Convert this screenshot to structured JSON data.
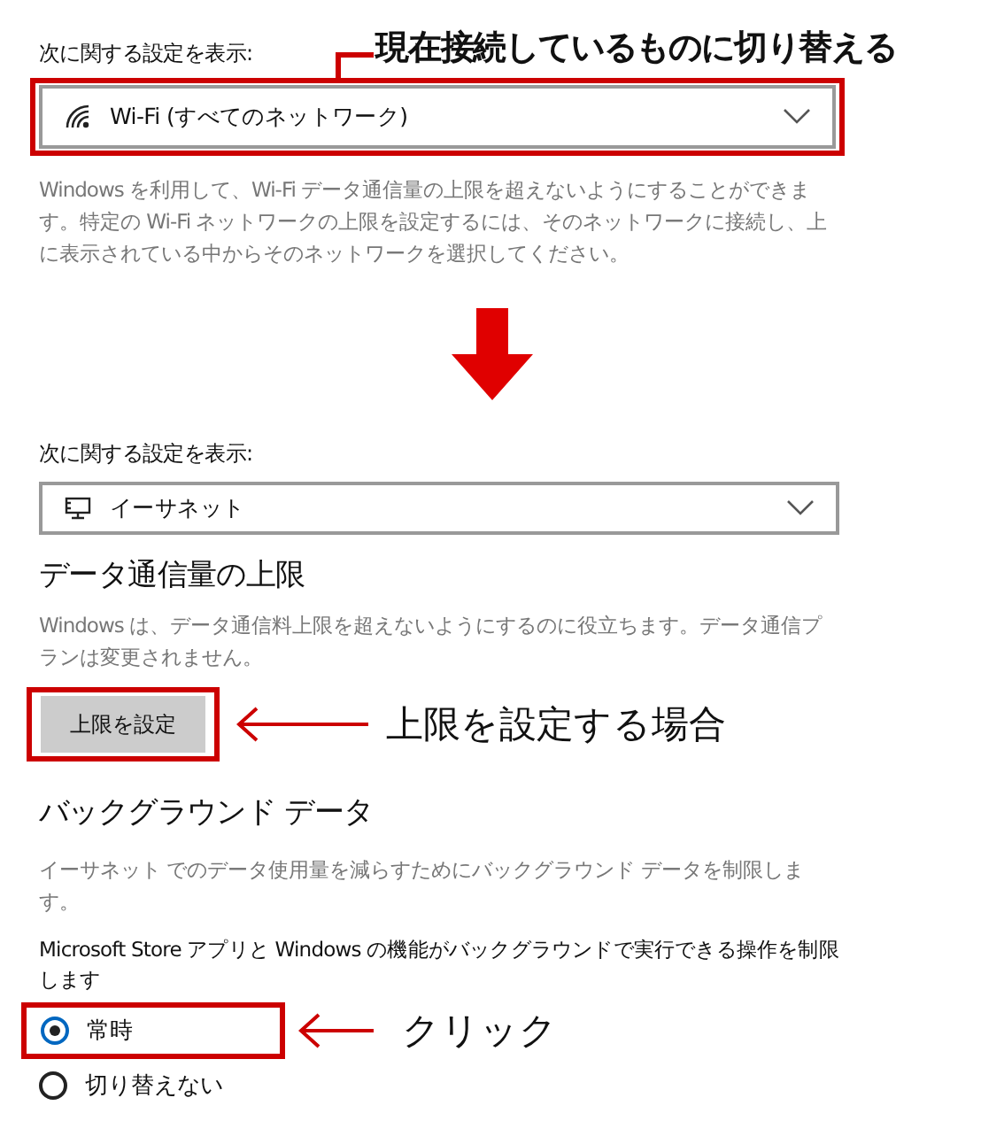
{
  "sections": [
    {
      "label": "次に関する設定を表示:",
      "dropdown": {
        "kind": "wifi",
        "value": "Wi-Fi (すべてのネットワーク)"
      },
      "description": "Windows を利用して、Wi-Fi データ通信量の上限を超えないようにすることができます。特定の Wi-Fi ネットワークの上限を設定するには、そのネットワークに接続し、上に表示されている中からそのネットワークを選択してください。"
    },
    {
      "label": "次に関する設定を表示:",
      "dropdown": {
        "kind": "ethernet",
        "value": "イーサネット"
      }
    }
  ],
  "data_limit": {
    "heading": "データ通信量の上限",
    "description": "Windows は、データ通信料上限を超えないようにするのに役立ちます。データ通信プランは変更されません。",
    "button": "上限を設定"
  },
  "background_data": {
    "heading": "バックグラウンド データ",
    "description": "イーサネット でのデータ使用量を減らすためにバックグラウンド データを制限します。",
    "prompt": "Microsoft Store アプリと Windows の機能がバックグラウンドで実行できる操作を制限します",
    "options": [
      {
        "label": "常時",
        "selected": true
      },
      {
        "label": "切り替えない",
        "selected": false
      }
    ]
  },
  "annotations": [
    {
      "text": "現在接続しているものに切り替える"
    },
    {
      "text": "上限を設定する場合"
    },
    {
      "text": "クリック"
    }
  ]
}
